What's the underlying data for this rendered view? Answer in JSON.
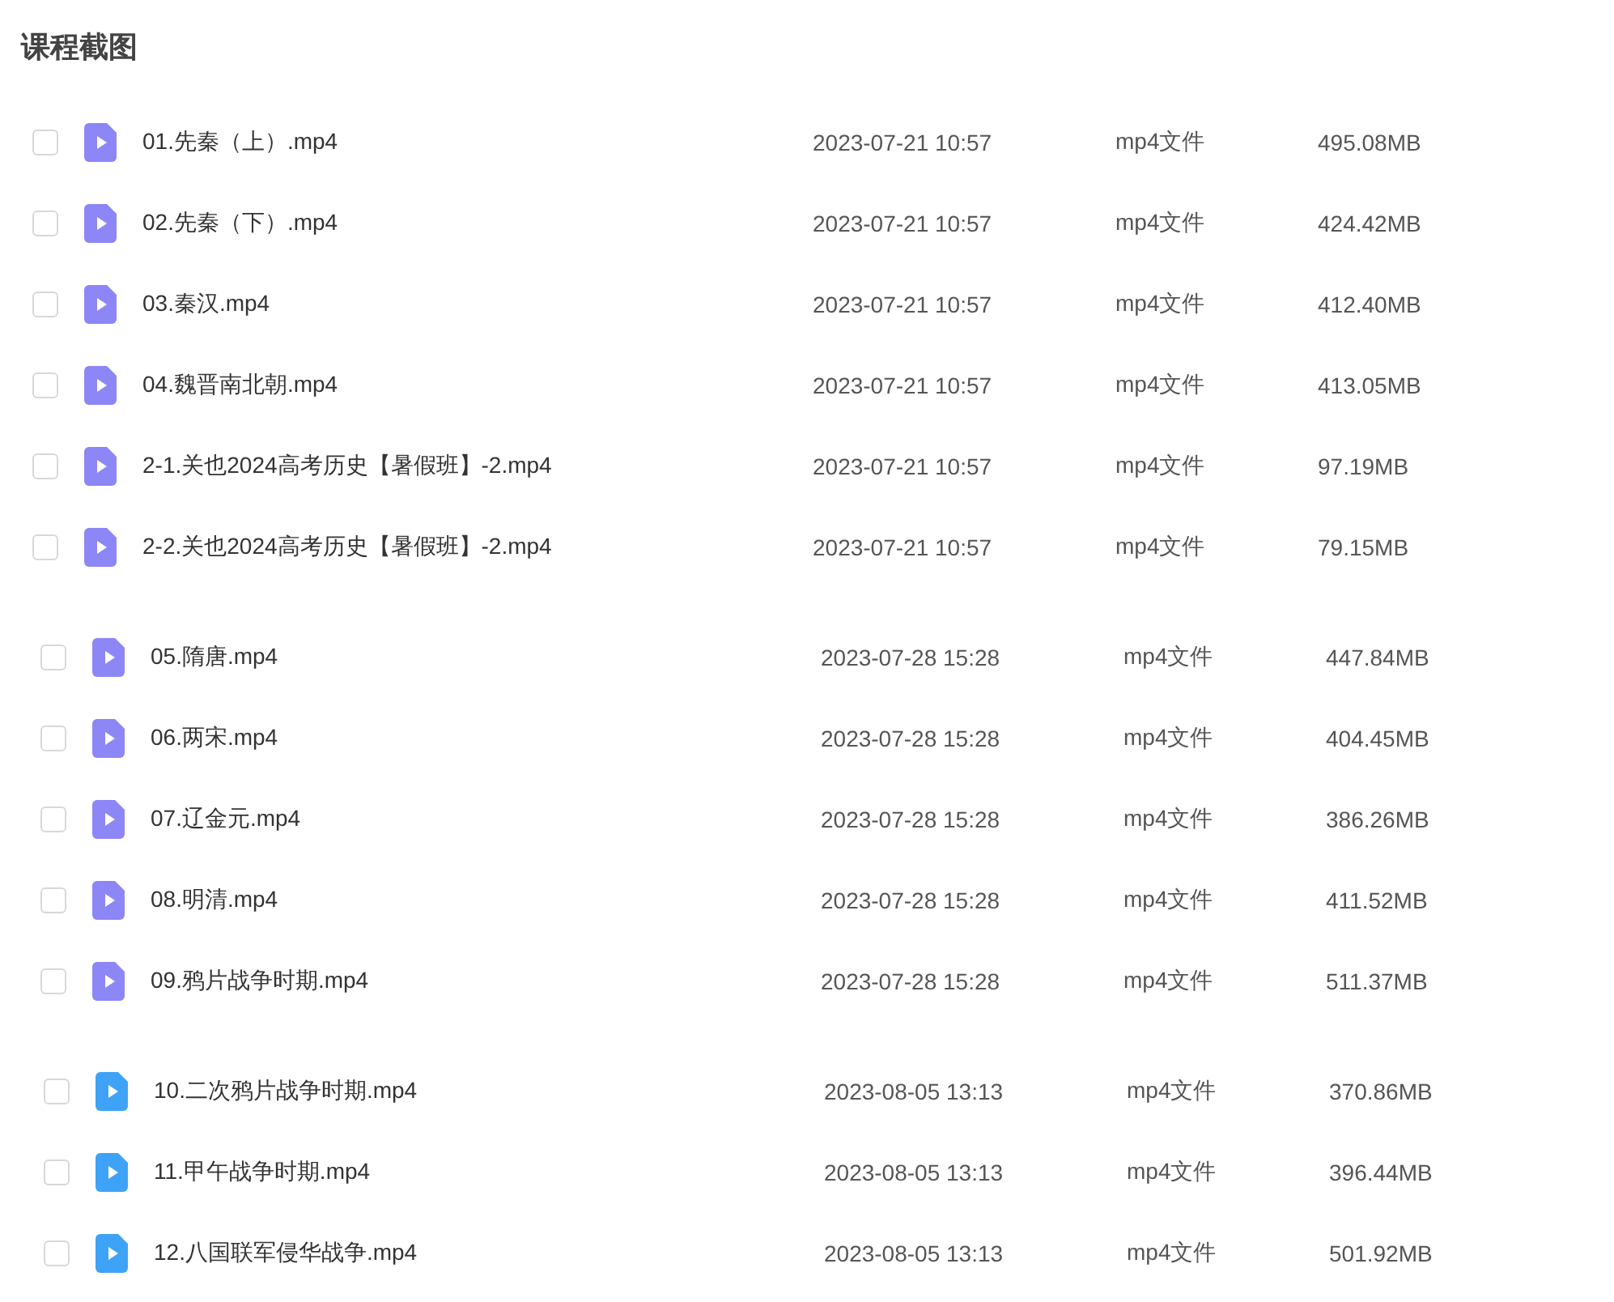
{
  "title": "课程截图",
  "groups": [
    {
      "files": [
        {
          "name": "01.先秦（上）.mp4",
          "date": "2023-07-21 10:57",
          "type": "mp4文件",
          "size": "495.08MB",
          "checked": false,
          "color": "#8c86f6"
        },
        {
          "name": "02.先秦（下）.mp4",
          "date": "2023-07-21 10:57",
          "type": "mp4文件",
          "size": "424.42MB",
          "checked": false,
          "color": "#8c86f6"
        },
        {
          "name": "03.秦汉.mp4",
          "date": "2023-07-21 10:57",
          "type": "mp4文件",
          "size": "412.40MB",
          "checked": false,
          "color": "#8c86f6"
        },
        {
          "name": "04.魏晋南北朝.mp4",
          "date": "2023-07-21 10:57",
          "type": "mp4文件",
          "size": "413.05MB",
          "checked": false,
          "color": "#8c86f6"
        },
        {
          "name": "2-1.关也2024高考历史【暑假班】-2.mp4",
          "date": "2023-07-21 10:57",
          "type": "mp4文件",
          "size": "97.19MB",
          "checked": false,
          "color": "#8c86f6"
        },
        {
          "name": "2-2.关也2024高考历史【暑假班】-2.mp4",
          "date": "2023-07-21 10:57",
          "type": "mp4文件",
          "size": "79.15MB",
          "checked": false,
          "color": "#8c86f6"
        }
      ]
    },
    {
      "files": [
        {
          "name": "05.隋唐.mp4",
          "date": "2023-07-28 15:28",
          "type": "mp4文件",
          "size": "447.84MB",
          "checked": false,
          "color": "#8c86f6"
        },
        {
          "name": "06.两宋.mp4",
          "date": "2023-07-28 15:28",
          "type": "mp4文件",
          "size": "404.45MB",
          "checked": false,
          "color": "#8c86f6"
        },
        {
          "name": "07.辽金元.mp4",
          "date": "2023-07-28 15:28",
          "type": "mp4文件",
          "size": "386.26MB",
          "checked": false,
          "color": "#8c86f6"
        },
        {
          "name": "08.明清.mp4",
          "date": "2023-07-28 15:28",
          "type": "mp4文件",
          "size": "411.52MB",
          "checked": false,
          "color": "#8c86f6"
        },
        {
          "name": "09.鸦片战争时期.mp4",
          "date": "2023-07-28 15:28",
          "type": "mp4文件",
          "size": "511.37MB",
          "checked": false,
          "color": "#8c86f6"
        }
      ]
    },
    {
      "files": [
        {
          "name": "10.二次鸦片战争时期.mp4",
          "date": "2023-08-05 13:13",
          "type": "mp4文件",
          "size": "370.86MB",
          "checked": false,
          "color": "#3ea3f6"
        },
        {
          "name": "11.甲午战争时期.mp4",
          "date": "2023-08-05 13:13",
          "type": "mp4文件",
          "size": "396.44MB",
          "checked": false,
          "color": "#3ea3f6"
        },
        {
          "name": "12.八国联军侵华战争.mp4",
          "date": "2023-08-05 13:13",
          "type": "mp4文件",
          "size": "501.92MB",
          "checked": false,
          "color": "#3ea3f6"
        }
      ]
    }
  ]
}
